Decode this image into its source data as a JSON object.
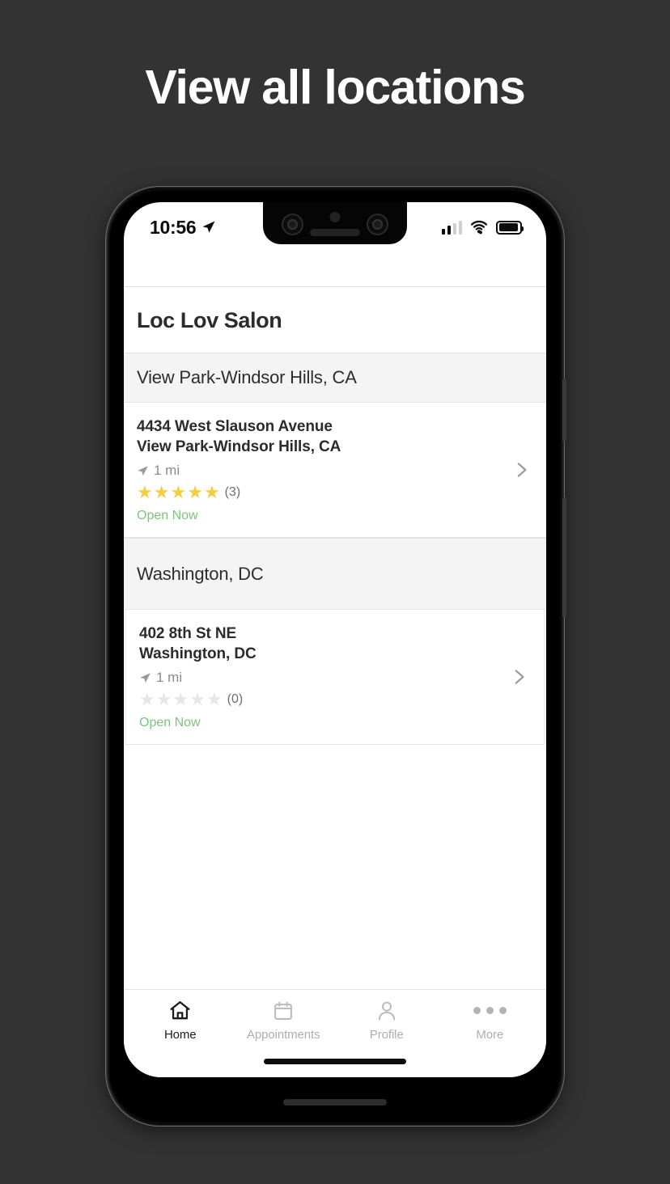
{
  "promo": {
    "heading": "View all locations"
  },
  "colors": {
    "page_background": "#333333",
    "heading_text": "#ffffff",
    "star_filled": "#f3cf3f",
    "star_empty": "#e6e6e6",
    "open_now_text": "#7cc47f",
    "section_band": "#f4f4f4",
    "primary_text": "#2b2b2b",
    "muted_text": "#8b8b8b",
    "tab_active": "#1c1c1c",
    "tab_inactive": "#aeaeae"
  },
  "status_bar": {
    "time": "10:56",
    "location_icon": "navigation-arrow-icon",
    "signal_icon": "cellular-signal-icon",
    "signal_bars_filled": 2,
    "signal_bars_total": 4,
    "wifi_icon": "wifi-icon",
    "battery_icon": "battery-icon",
    "battery_level": 92
  },
  "notch": {
    "camera_left_icon": "camera-lens-icon",
    "camera_right_icon": "camera-lens-icon",
    "sensor_icon": "proximity-sensor-icon",
    "speaker_icon": "earpiece-speaker-icon"
  },
  "device": {
    "volume_button": "volume-button",
    "power_button": "power-button",
    "bottom_speaker": "speaker-grille",
    "home_indicator": "home-indicator"
  },
  "app": {
    "title": "Loc Lov Salon"
  },
  "sections": [
    {
      "header": "View Park-Windsor Hills, CA",
      "locations": [
        {
          "address_line1": "4434 West Slauson Avenue",
          "address_line2": "View Park-Windsor Hills, CA",
          "distance": "1 mi",
          "distance_icon": "navigation-arrow-icon",
          "rating": 5,
          "rating_count": "(3)",
          "status": "Open Now",
          "chevron_icon": "chevron-right-icon"
        }
      ]
    },
    {
      "header": "Washington, DC",
      "locations": [
        {
          "address_line1": "402 8th St NE",
          "address_line2": "Washington, DC",
          "distance": "1 mi",
          "distance_icon": "navigation-arrow-icon",
          "rating": 0,
          "rating_count": "(0)",
          "status": "Open Now",
          "chevron_icon": "chevron-right-icon"
        }
      ]
    }
  ],
  "tab_bar": {
    "items": [
      {
        "label": "Home",
        "icon": "home-icon",
        "active": true
      },
      {
        "label": "Appointments",
        "icon": "calendar-icon",
        "active": false
      },
      {
        "label": "Profile",
        "icon": "person-icon",
        "active": false
      },
      {
        "label": "More",
        "icon": "ellipsis-icon",
        "active": false
      }
    ]
  }
}
